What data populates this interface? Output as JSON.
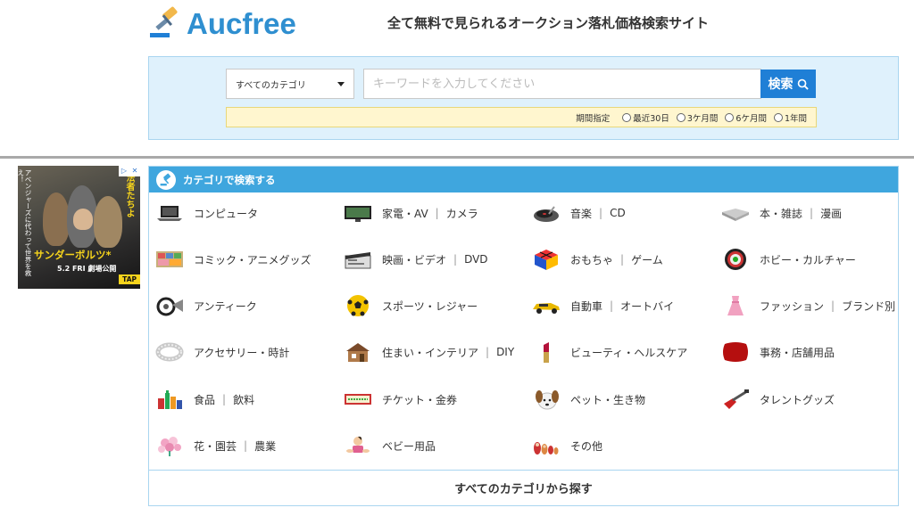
{
  "header": {
    "logo_text": "Aucfree",
    "tagline": "全て無料で見られるオークション落札価格検索サイト"
  },
  "search": {
    "category_selected": "すべてのカテゴリ",
    "keyword_placeholder": "キーワードを入力してください",
    "keyword_value": "",
    "button_label": "検索",
    "period_label": "期間指定",
    "period_options": [
      "最近30日",
      "3ケ月間",
      "6ケ月間",
      "1年間"
    ]
  },
  "ad": {
    "vertical_text": "アベンジャーズに代わって世界を救え！",
    "side_text": "法者たちよ",
    "title": "サンダーボルツ*",
    "date": "5.2 FRI 劇場公開",
    "tap": "TAP",
    "info": "▷",
    "close": "✕"
  },
  "categories": {
    "header": "カテゴリで検索する",
    "items": [
      {
        "parts": [
          "コンピュータ"
        ],
        "icon": "laptop-icon"
      },
      {
        "parts": [
          "家電・AV",
          "カメラ"
        ],
        "icon": "tv-icon"
      },
      {
        "parts": [
          "音楽",
          "CD"
        ],
        "icon": "turntable-icon"
      },
      {
        "parts": [
          "本・雑誌",
          "漫画"
        ],
        "icon": "book-icon"
      },
      {
        "parts": [
          "コミック・アニメグッズ"
        ],
        "icon": "comic-icon"
      },
      {
        "parts": [
          "映画・ビデオ",
          "DVD"
        ],
        "icon": "clapper-icon"
      },
      {
        "parts": [
          "おもちゃ",
          "ゲーム"
        ],
        "icon": "rubiks-cube-icon"
      },
      {
        "parts": [
          "ホビー・カルチャー"
        ],
        "icon": "dartboard-icon"
      },
      {
        "parts": [
          "アンティーク"
        ],
        "icon": "gramophone-icon"
      },
      {
        "parts": [
          "スポーツ・レジャー"
        ],
        "icon": "soccer-ball-icon"
      },
      {
        "parts": [
          "自動車",
          "オートバイ"
        ],
        "icon": "car-icon"
      },
      {
        "parts": [
          "ファッション",
          "ブランド別"
        ],
        "icon": "dress-icon"
      },
      {
        "parts": [
          "アクセサリー・時計"
        ],
        "icon": "bracelet-icon"
      },
      {
        "parts": [
          "住まい・インテリア",
          "DIY"
        ],
        "icon": "house-icon"
      },
      {
        "parts": [
          "ビューティ・ヘルスケア"
        ],
        "icon": "lipstick-icon"
      },
      {
        "parts": [
          "事務・店舗用品"
        ],
        "icon": "cushion-icon"
      },
      {
        "parts": [
          "食品",
          "飲料"
        ],
        "icon": "bottles-icon"
      },
      {
        "parts": [
          "チケット・金券"
        ],
        "icon": "ticket-icon"
      },
      {
        "parts": [
          "ペット・生き物"
        ],
        "icon": "dog-icon"
      },
      {
        "parts": [
          "タレントグッズ"
        ],
        "icon": "guitar-icon"
      },
      {
        "parts": [
          "花・園芸",
          "農業"
        ],
        "icon": "flower-icon"
      },
      {
        "parts": [
          "ベビー用品"
        ],
        "icon": "baby-icon"
      },
      {
        "parts": [
          "その他"
        ],
        "icon": "dolls-icon"
      }
    ],
    "all_label": "すべてのカテゴリから探す"
  },
  "colors": {
    "brand": "#2f8fd0",
    "search_bg": "#dff1fc",
    "button": "#1f7fd6",
    "header_bar": "#3fa6de",
    "period_bg": "#fff6cf"
  }
}
